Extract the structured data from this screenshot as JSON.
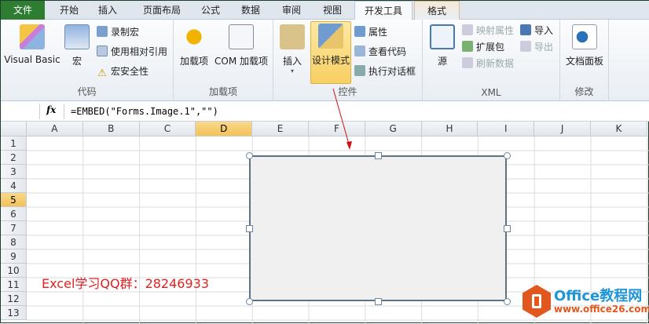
{
  "tabs": [
    "文件",
    "开始",
    "插入",
    "页面布局",
    "公式",
    "数据",
    "审阅",
    "视图",
    "开发工具",
    "格式"
  ],
  "groups": {
    "code": {
      "label": "代码",
      "visual_basic": "Visual Basic",
      "macros": "宏",
      "record_macro": "录制宏",
      "relative_ref": "使用相对引用",
      "macro_security": "宏安全性"
    },
    "addins": {
      "label": "加载项",
      "addins": "加载项",
      "com_addins": "COM 加载项"
    },
    "controls": {
      "label": "控件",
      "insert": "插入",
      "design_mode": "设计模式",
      "properties": "属性",
      "view_code": "查看代码",
      "run_dialog": "执行对话框"
    },
    "xml": {
      "label": "XML",
      "source": "源",
      "map_props": "映射属性",
      "expansion": "扩展包",
      "refresh": "刷新数据",
      "import": "导入",
      "export": "导出"
    },
    "modify": {
      "label": "修改",
      "doc_panel": "文档面板"
    }
  },
  "formula_bar": {
    "fx": "fx",
    "formula": "=EMBED(\"Forms.Image.1\",\"\")"
  },
  "columns": [
    "A",
    "B",
    "C",
    "D",
    "E",
    "F",
    "G",
    "H",
    "I",
    "J",
    "K"
  ],
  "rows": [
    "1",
    "2",
    "3",
    "4",
    "5",
    "6",
    "7",
    "8",
    "9",
    "10",
    "11",
    "12",
    "13"
  ],
  "selected_column": "D",
  "selected_row": "5",
  "annotation": "Excel学习QQ群：28246933",
  "watermark": {
    "title": "Office教程网",
    "url": "www.office26.com"
  }
}
